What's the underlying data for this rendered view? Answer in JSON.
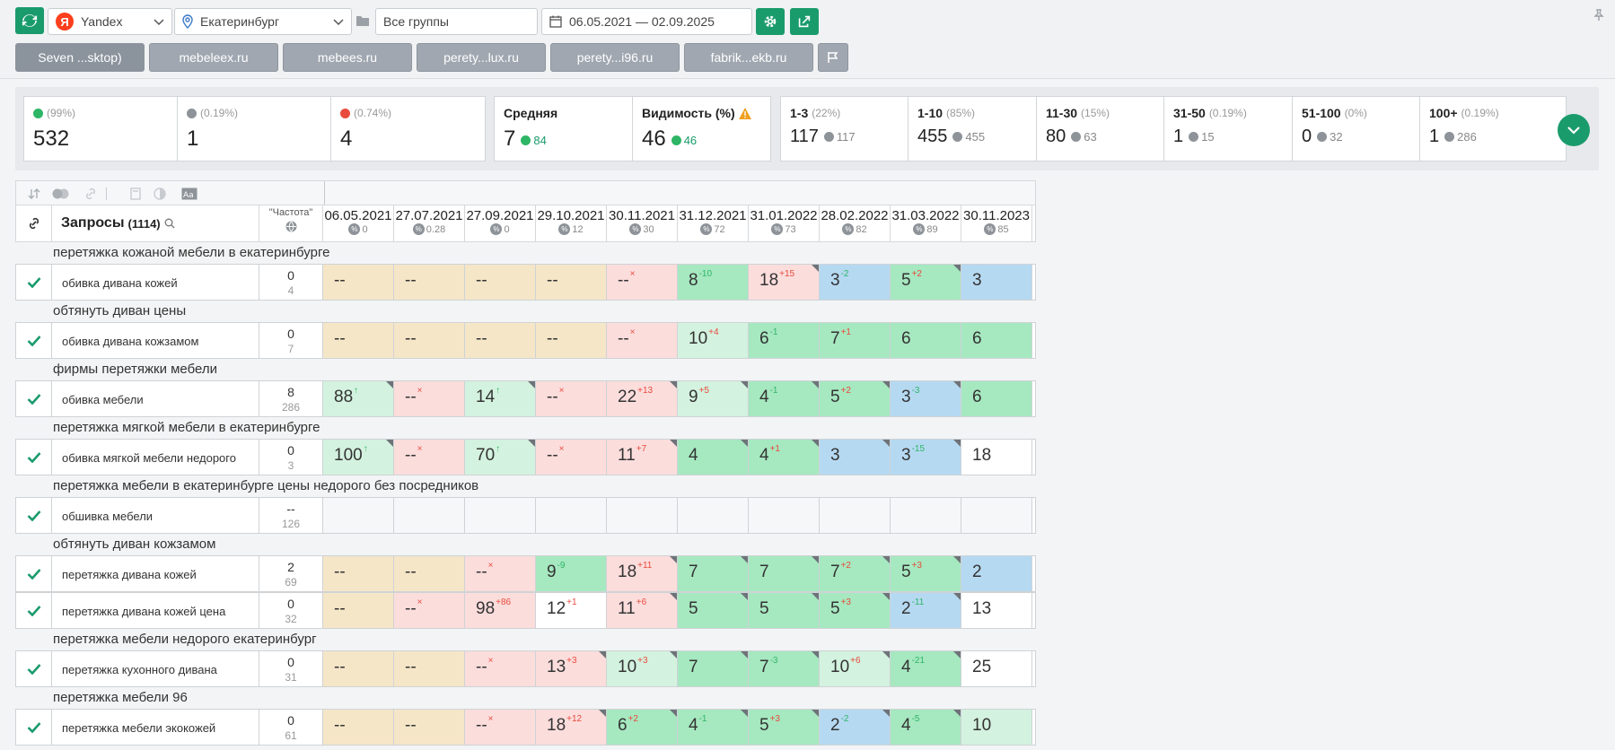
{
  "toolbar": {
    "engine": "Yandex",
    "region": "Екатеринбург",
    "group": "Все группы",
    "dates": "06.05.2021 — 02.09.2025"
  },
  "tabs": [
    "Seven ...sktop)",
    "mebeleex.ru",
    "mebees.ru",
    "perety...lux.ru",
    "perety...i96.ru",
    "fabrik...ekb.ru"
  ],
  "stats": {
    "up": {
      "pct": "(99%)",
      "value": "532"
    },
    "same": {
      "pct": "(0.19%)",
      "value": "1"
    },
    "down": {
      "pct": "(0.74%)",
      "value": "4"
    },
    "avg": {
      "label": "Средняя",
      "value": "7",
      "delta": "84"
    },
    "visibility": {
      "label": "Видимость (%)",
      "value": "46",
      "delta": "46"
    },
    "ranges": [
      {
        "label": "1-3",
        "pct": "(22%)",
        "value": "117",
        "prev": "117"
      },
      {
        "label": "1-10",
        "pct": "(85%)",
        "value": "455",
        "prev": "455"
      },
      {
        "label": "11-30",
        "pct": "(15%)",
        "value": "80",
        "prev": "63"
      },
      {
        "label": "31-50",
        "pct": "(0.19%)",
        "value": "1",
        "prev": "15"
      },
      {
        "label": "51-100",
        "pct": "(0%)",
        "value": "0",
        "prev": "32"
      },
      {
        "label": "100+",
        "pct": "(0.19%)",
        "value": "1",
        "prev": "286"
      }
    ]
  },
  "table": {
    "queries_label": "Запросы",
    "queries_count": "(1114)",
    "freq_label": "\"Частота\"",
    "dates": [
      {
        "date": "06.05.2021",
        "sub": "0"
      },
      {
        "date": "27.07.2021",
        "sub": "0.28"
      },
      {
        "date": "27.09.2021",
        "sub": "0"
      },
      {
        "date": "29.10.2021",
        "sub": "12"
      },
      {
        "date": "30.11.2021",
        "sub": "30"
      },
      {
        "date": "31.12.2021",
        "sub": "72"
      },
      {
        "date": "31.01.2022",
        "sub": "73"
      },
      {
        "date": "28.02.2022",
        "sub": "82"
      },
      {
        "date": "31.03.2022",
        "sub": "89"
      },
      {
        "date": "30.11.2023",
        "sub": "85"
      }
    ],
    "rows": [
      {
        "group": "перетяжка кожаной мебели в екатеринбурге",
        "query": "обивка дивана кожей",
        "f1": "0",
        "f2": "4",
        "cells": [
          [
            "--",
            "",
            "",
            "tan",
            0
          ],
          [
            "--",
            "",
            "",
            "tan",
            0
          ],
          [
            "--",
            "",
            "",
            "tan",
            0
          ],
          [
            "--",
            "",
            "",
            "tan",
            0
          ],
          [
            "--",
            "×",
            "x",
            "pink",
            0
          ],
          [
            "8",
            "-10",
            "up",
            "green",
            0
          ],
          [
            "18",
            "+15",
            "dn",
            "pink",
            1
          ],
          [
            "3",
            "-2",
            "up",
            "blue",
            0
          ],
          [
            "5",
            "+2",
            "dn",
            "green",
            1
          ],
          [
            "3",
            "",
            "",
            "blue",
            0
          ]
        ]
      },
      {
        "group": "обтянуть диван цены",
        "query": "обивка дивана кожзамом",
        "f1": "0",
        "f2": "7",
        "cells": [
          [
            "--",
            "",
            "",
            "tan",
            0
          ],
          [
            "--",
            "",
            "",
            "tan",
            0
          ],
          [
            "--",
            "",
            "",
            "tan",
            0
          ],
          [
            "--",
            "",
            "",
            "tan",
            0
          ],
          [
            "--",
            "×",
            "x",
            "pink",
            0
          ],
          [
            "10",
            "+4",
            "dn",
            "lgreen",
            0
          ],
          [
            "6",
            "-1",
            "up",
            "green",
            0
          ],
          [
            "7",
            "+1",
            "dn",
            "green",
            0
          ],
          [
            "6",
            "",
            "",
            "green",
            0
          ],
          [
            "6",
            "",
            "",
            "green",
            0
          ]
        ]
      },
      {
        "group": "фирмы перетяжки мебели",
        "query": "обивка мебели",
        "f1": "8",
        "f2": "286",
        "cells": [
          [
            "88",
            "↑",
            "up",
            "lgreen",
            1
          ],
          [
            "--",
            "×",
            "x",
            "pink",
            0
          ],
          [
            "14",
            "↑",
            "up",
            "lgreen",
            1
          ],
          [
            "--",
            "×",
            "x",
            "pink",
            0
          ],
          [
            "22",
            "+13",
            "dn",
            "pink",
            1
          ],
          [
            "9",
            "+5",
            "dn",
            "lgreen",
            1
          ],
          [
            "4",
            "-1",
            "up",
            "green",
            1
          ],
          [
            "5",
            "+2",
            "dn",
            "green",
            1
          ],
          [
            "3",
            "-3",
            "up",
            "blue",
            1
          ],
          [
            "6",
            "",
            "",
            "green",
            0
          ]
        ]
      },
      {
        "group": "перетяжка мягкой мебели в екатеринбурге",
        "query": "обивка мягкой мебели недорого",
        "f1": "0",
        "f2": "3",
        "cells": [
          [
            "100",
            "↑",
            "up",
            "lgreen",
            1
          ],
          [
            "--",
            "×",
            "x",
            "pink",
            0
          ],
          [
            "70",
            "↑",
            "up",
            "lgreen",
            1
          ],
          [
            "--",
            "×",
            "x",
            "pink",
            0
          ],
          [
            "11",
            "+7",
            "dn",
            "pink",
            1
          ],
          [
            "4",
            "",
            "",
            "green",
            1
          ],
          [
            "4",
            "+1",
            "dn",
            "green",
            1
          ],
          [
            "3",
            "",
            "",
            "blue",
            1
          ],
          [
            "3",
            "-15",
            "up",
            "blue",
            1
          ],
          [
            "18",
            "",
            "",
            "white",
            0
          ]
        ]
      },
      {
        "group": "перетяжка мебели в екатеринбурге цены недорого без посредников",
        "query": "обшивка мебели",
        "f1": "--",
        "f2": "126",
        "cells": [
          [
            "",
            "",
            "",
            "empty",
            0
          ],
          [
            "",
            "",
            "",
            "empty",
            0
          ],
          [
            "",
            "",
            "",
            "empty",
            0
          ],
          [
            "",
            "",
            "",
            "empty",
            0
          ],
          [
            "",
            "",
            "",
            "empty",
            0
          ],
          [
            "",
            "",
            "",
            "empty",
            0
          ],
          [
            "",
            "",
            "",
            "empty",
            0
          ],
          [
            "",
            "",
            "",
            "empty",
            0
          ],
          [
            "",
            "",
            "",
            "empty",
            0
          ],
          [
            "",
            "",
            "",
            "empty",
            0
          ]
        ]
      },
      {
        "group": "обтянуть диван кожзамом",
        "query": "перетяжка дивана кожей",
        "f1": "2",
        "f2": "69",
        "cells": [
          [
            "--",
            "",
            "",
            "tan",
            0
          ],
          [
            "--",
            "",
            "",
            "tan",
            0
          ],
          [
            "--",
            "×",
            "x",
            "pink",
            0
          ],
          [
            "9",
            "-9",
            "up",
            "green",
            0
          ],
          [
            "18",
            "+11",
            "dn",
            "pink",
            1
          ],
          [
            "7",
            "",
            "",
            "green",
            1
          ],
          [
            "7",
            "",
            "",
            "green",
            1
          ],
          [
            "7",
            "+2",
            "dn",
            "green",
            1
          ],
          [
            "5",
            "+3",
            "dn",
            "green",
            1
          ],
          [
            "2",
            "",
            "",
            "blue",
            0
          ]
        ]
      },
      {
        "group": "",
        "query": "перетяжка дивана кожей цена",
        "f1": "0",
        "f2": "32",
        "cells": [
          [
            "--",
            "",
            "",
            "tan",
            0
          ],
          [
            "--",
            "×",
            "x",
            "pink",
            0
          ],
          [
            "98",
            "+86",
            "dn",
            "pink",
            0
          ],
          [
            "12",
            "+1",
            "dn",
            "white",
            0
          ],
          [
            "11",
            "+6",
            "dn",
            "pink",
            1
          ],
          [
            "5",
            "",
            "",
            "green",
            1
          ],
          [
            "5",
            "",
            "",
            "green",
            1
          ],
          [
            "5",
            "+3",
            "dn",
            "green",
            1
          ],
          [
            "2",
            "-11",
            "up",
            "blue",
            1
          ],
          [
            "13",
            "",
            "",
            "white",
            0
          ]
        ]
      },
      {
        "group": "перетяжка мебели недорого екатеринбург",
        "query": "перетяжка кухонного дивана",
        "f1": "0",
        "f2": "31",
        "cells": [
          [
            "--",
            "",
            "",
            "tan",
            0
          ],
          [
            "--",
            "",
            "",
            "tan",
            0
          ],
          [
            "--",
            "×",
            "x",
            "pink",
            0
          ],
          [
            "13",
            "+3",
            "dn",
            "pink",
            1
          ],
          [
            "10",
            "+3",
            "dn",
            "lgreen",
            1
          ],
          [
            "7",
            "",
            "",
            "green",
            1
          ],
          [
            "7",
            "-3",
            "up",
            "green",
            1
          ],
          [
            "10",
            "+6",
            "dn",
            "lgreen",
            1
          ],
          [
            "4",
            "-21",
            "up",
            "green",
            1
          ],
          [
            "25",
            "",
            "",
            "white",
            0
          ]
        ]
      },
      {
        "group": "перетяжка мебели 96",
        "query": "перетяжка мебели экокожей",
        "f1": "0",
        "f2": "61",
        "cells": [
          [
            "--",
            "",
            "",
            "tan",
            0
          ],
          [
            "--",
            "",
            "",
            "tan",
            0
          ],
          [
            "--",
            "×",
            "x",
            "pink",
            0
          ],
          [
            "18",
            "+12",
            "dn",
            "pink",
            1
          ],
          [
            "6",
            "+2",
            "dn",
            "green",
            1
          ],
          [
            "4",
            "-1",
            "up",
            "green",
            1
          ],
          [
            "5",
            "+3",
            "dn",
            "green",
            1
          ],
          [
            "2",
            "-2",
            "up",
            "blue",
            1
          ],
          [
            "4",
            "-5",
            "up",
            "green",
            1
          ],
          [
            "10",
            "",
            "",
            "lgreen",
            0
          ]
        ]
      }
    ]
  }
}
